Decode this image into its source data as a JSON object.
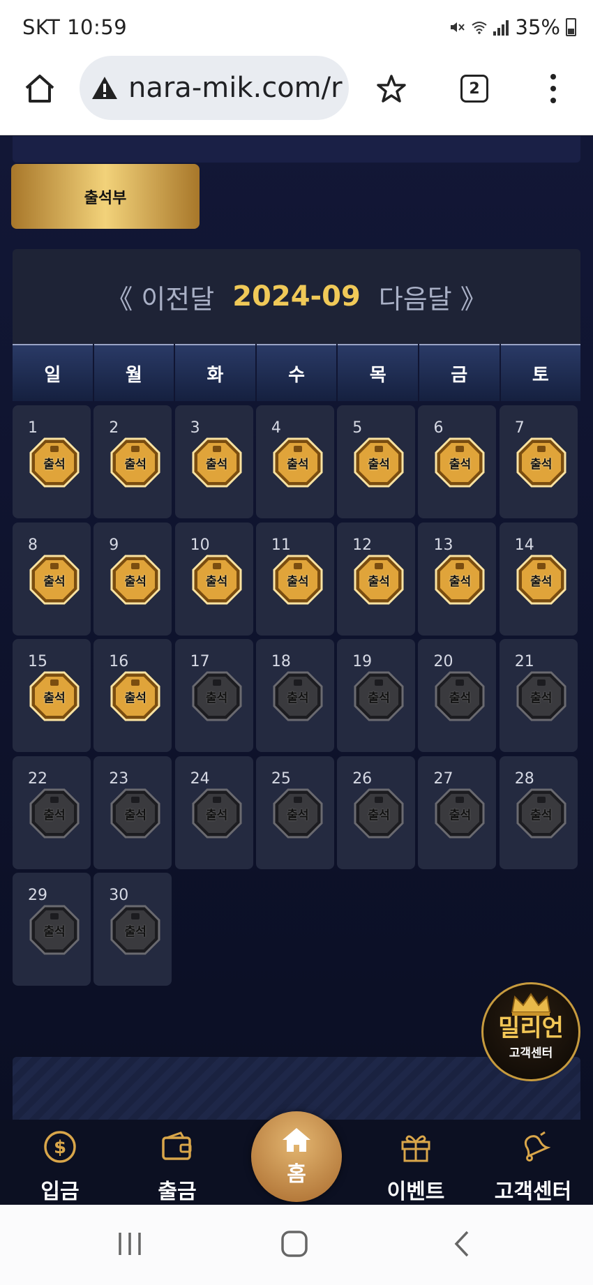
{
  "status_bar": {
    "carrier_time": "SKT 10:59",
    "battery": "35%"
  },
  "browser": {
    "url": "nara-mik.com/r",
    "tab_count": "2"
  },
  "page": {
    "attendance_tab": "출석부",
    "calendar": {
      "prev": "《 이전달",
      "month": "2024-09",
      "next": "다음달 》",
      "weekdays": [
        "일",
        "월",
        "화",
        "수",
        "목",
        "금",
        "토"
      ],
      "days": [
        {
          "n": "1",
          "checked": true
        },
        {
          "n": "2",
          "checked": true
        },
        {
          "n": "3",
          "checked": true
        },
        {
          "n": "4",
          "checked": true
        },
        {
          "n": "5",
          "checked": true
        },
        {
          "n": "6",
          "checked": true
        },
        {
          "n": "7",
          "checked": true
        },
        {
          "n": "8",
          "checked": true
        },
        {
          "n": "9",
          "checked": true
        },
        {
          "n": "10",
          "checked": true
        },
        {
          "n": "11",
          "checked": true
        },
        {
          "n": "12",
          "checked": true
        },
        {
          "n": "13",
          "checked": true
        },
        {
          "n": "14",
          "checked": true
        },
        {
          "n": "15",
          "checked": true
        },
        {
          "n": "16",
          "checked": true
        },
        {
          "n": "17",
          "checked": false
        },
        {
          "n": "18",
          "checked": false
        },
        {
          "n": "19",
          "checked": false
        },
        {
          "n": "20",
          "checked": false
        },
        {
          "n": "21",
          "checked": false
        },
        {
          "n": "22",
          "checked": false
        },
        {
          "n": "23",
          "checked": false
        },
        {
          "n": "24",
          "checked": false
        },
        {
          "n": "25",
          "checked": false
        },
        {
          "n": "26",
          "checked": false
        },
        {
          "n": "27",
          "checked": false
        },
        {
          "n": "28",
          "checked": false
        },
        {
          "n": "29",
          "checked": false
        },
        {
          "n": "30",
          "checked": false
        }
      ],
      "badge_text": "출석",
      "colors": {
        "checked": "#e0a43a",
        "unchecked": "#3a3a3e"
      }
    }
  },
  "cs_float": {
    "title": "밀리언",
    "subtitle": "고객센터"
  },
  "bottom_nav": {
    "deposit": "입금",
    "withdraw": "출금",
    "home": "홈",
    "event": "이벤트",
    "support": "고객센터"
  }
}
